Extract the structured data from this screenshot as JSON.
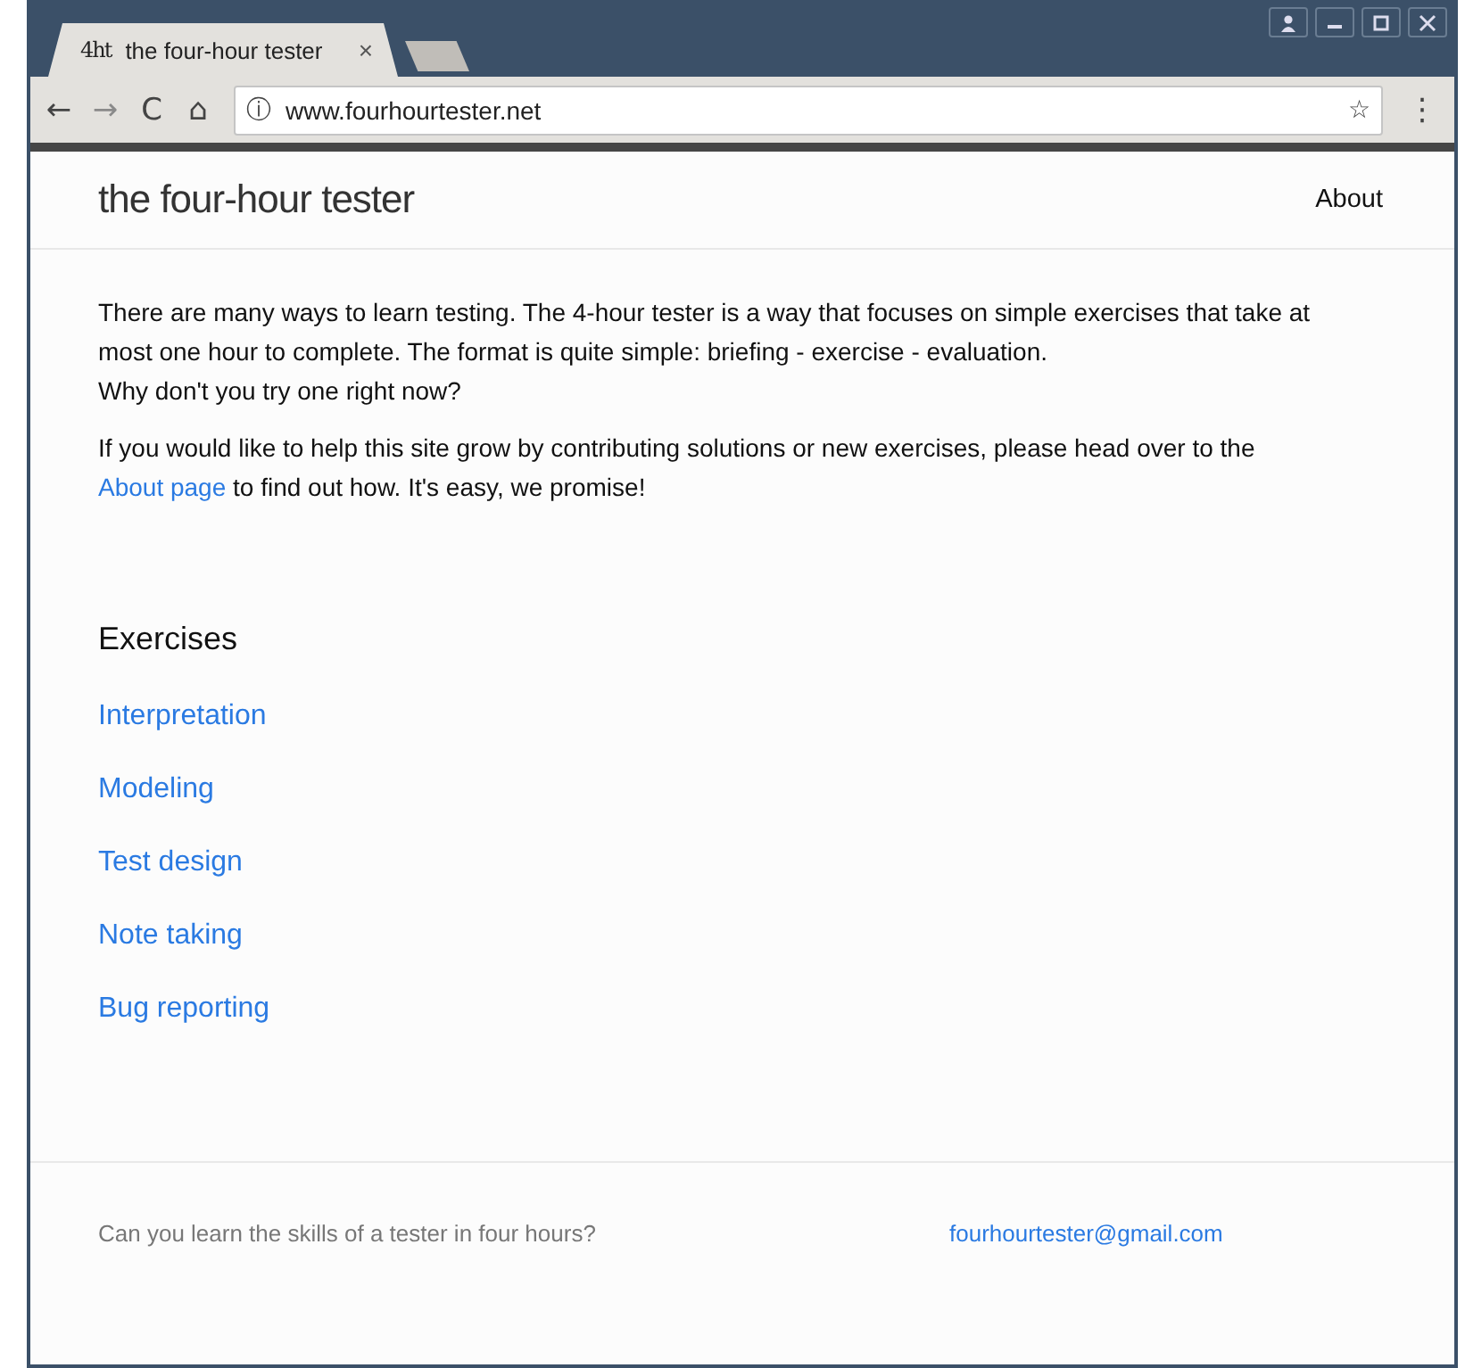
{
  "browser": {
    "tabs": [
      {
        "favicon": "4ht",
        "title": "the four-hour tester",
        "close": "×",
        "selected": true
      },
      {
        "kind": "new-tab",
        "selected": false
      }
    ],
    "nav": {
      "back": "←",
      "forward": "→",
      "forward_disabled": true,
      "reload": "C",
      "home": "⌂"
    },
    "address": {
      "info": "ⓘ",
      "url": "www.fourhourtester.net",
      "star": "☆",
      "menu": "⋮"
    }
  },
  "header": {
    "title": "the four-hour tester",
    "nav": [
      {
        "label": "About"
      }
    ]
  },
  "intro": {
    "lines": [
      "There are many ways to learn testing. The 4-hour tester is a way that focuses on simple exercises that take at most one hour to complete. The format is quite simple: briefing - exercise - evaluation.",
      "Why don't you try one right now?"
    ]
  },
  "help": {
    "before": "If you would like to help this site grow by contributing solutions or new exercises, please head over to the ",
    "link": "About page",
    "after": " to find out how. It's easy, we promise!"
  },
  "exercises": {
    "heading": "Exercises",
    "items": [
      {
        "label": "Interpretation"
      },
      {
        "label": "Modeling"
      },
      {
        "label": "Test design"
      },
      {
        "label": "Note taking"
      },
      {
        "label": "Bug reporting"
      }
    ]
  },
  "footer": {
    "tagline": "Can you learn the skills of a tester in four hours?",
    "email": "fourhourtester@gmail.com"
  }
}
